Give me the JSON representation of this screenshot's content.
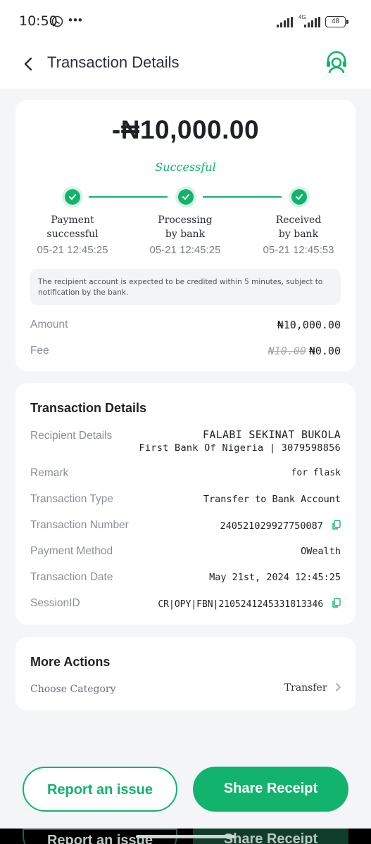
{
  "status_bar": {
    "time": "10:50",
    "dots": "•••",
    "network": "4G",
    "battery": "48"
  },
  "header": {
    "title": "Transaction Details"
  },
  "summary": {
    "amount": "-₦10,000.00",
    "status": "Successful",
    "steps": [
      {
        "label_line1": "Payment",
        "label_line2": "successful",
        "time": "05-21 12:45:25"
      },
      {
        "label_line1": "Processing",
        "label_line2": "by bank",
        "time": "05-21 12:45:25"
      },
      {
        "label_line1": "Received",
        "label_line2": "by bank",
        "time": "05-21 12:45:53"
      }
    ],
    "note": "The recipient account is expected to be credited within 5 minutes, subject to notification by the bank.",
    "amount_label": "Amount",
    "amount_value": "₦10,000.00",
    "fee_label": "Fee",
    "fee_original": "₦10.00",
    "fee_value": "₦0.00"
  },
  "details": {
    "title": "Transaction Details",
    "recipient_label": "Recipient Details",
    "recipient_name": "FALABI SEKINAT BUKOLA",
    "recipient_bank": "First Bank Of Nigeria | 3079598856",
    "remark_label": "Remark",
    "remark_value": "for flask",
    "type_label": "Transaction Type",
    "type_value": "Transfer to Bank Account",
    "number_label": "Transaction Number",
    "number_value": "240521029927750087",
    "method_label": "Payment Method",
    "method_value": "OWealth",
    "date_label": "Transaction Date",
    "date_value": "May 21st, 2024 12:45:25",
    "session_label": "SessionID",
    "session_value": "CR|OPY|FBN|2105241245331813346"
  },
  "actions": {
    "title": "More Actions",
    "category_label": "Choose Category",
    "category_value": "Transfer"
  },
  "buttons": {
    "report": "Report an issue",
    "share": "Share Receipt"
  },
  "colors": {
    "accent": "#12b36c",
    "background": "#f4f5f7",
    "card": "#ffffff"
  }
}
